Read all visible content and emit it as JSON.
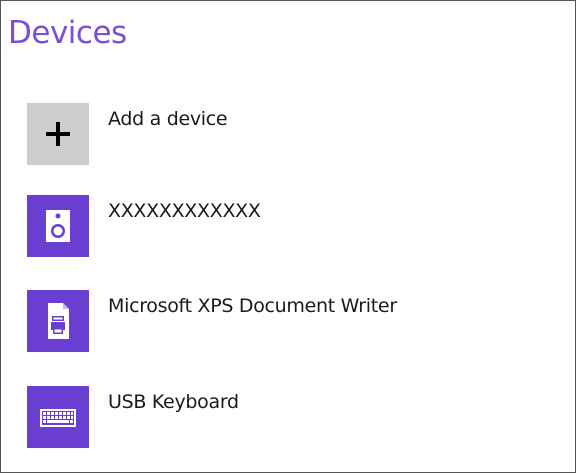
{
  "page": {
    "title": "Devices"
  },
  "devices": [
    {
      "label": "Add a device",
      "icon": "plus-icon",
      "tile_color": "#cdcdcd"
    },
    {
      "label": "XXXXXXXXXXXX",
      "icon": "speaker-icon",
      "tile_color": "#6a3ed1"
    },
    {
      "label": "Microsoft XPS Document Writer",
      "icon": "printer-document-icon",
      "tile_color": "#6a3ed1"
    },
    {
      "label": "USB Keyboard",
      "icon": "keyboard-icon",
      "tile_color": "#6a3ed1"
    }
  ],
  "colors": {
    "accent": "#7a4fd6",
    "tile_purple": "#6a3ed1",
    "tile_gray": "#cdcdcd",
    "text": "#1a1a1a",
    "border": "#555555"
  }
}
